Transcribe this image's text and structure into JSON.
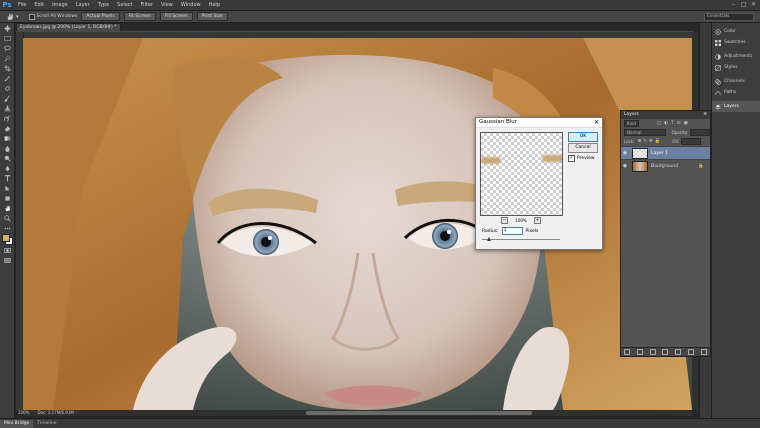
{
  "app": {
    "logo": "Ps"
  },
  "menu": [
    "File",
    "Edit",
    "Image",
    "Layer",
    "Type",
    "Select",
    "Filter",
    "View",
    "Window",
    "Help"
  ],
  "window_controls": [
    "–",
    "□",
    "✕"
  ],
  "options_bar": {
    "scroll_all_label": "Scroll All Windows",
    "buttons": [
      "Actual Pixels",
      "Fit Screen",
      "Fill Screen",
      "Print Size"
    ],
    "workspace": "Essentials"
  },
  "document": {
    "tab_title": "Eyebrows.jpg @ 200% (Layer 1, RGB/8#) *",
    "zoom": "200%",
    "doc_info": "Doc: 3.17M/6.91M"
  },
  "bottom_tabs": [
    "Mini Bridge",
    "Timeline"
  ],
  "dock_panels": [
    {
      "label": "Color",
      "icon": "color-icon"
    },
    {
      "label": "Swatches",
      "icon": "swatches-icon"
    },
    {
      "label": "Adjustments",
      "icon": "adjustments-icon"
    },
    {
      "label": "Styles",
      "icon": "styles-icon"
    },
    {
      "label": "Channels",
      "icon": "channels-icon"
    },
    {
      "label": "Paths",
      "icon": "paths-icon"
    },
    {
      "label": "Layers",
      "icon": "layers-icon"
    }
  ],
  "layers_panel": {
    "title": "Layers",
    "filter": "Kind",
    "blend_mode": "Normal",
    "opacity_label": "Opacity:",
    "lock_label": "Lock:",
    "fill_label": "Fill:",
    "layers": [
      {
        "name": "Layer 1",
        "selected": true
      },
      {
        "name": "Background",
        "selected": false
      }
    ]
  },
  "gaussian_blur": {
    "title": "Gaussian Blur",
    "ok_label": "OK",
    "cancel_label": "Cancel",
    "preview_label": "Preview",
    "preview_checked": true,
    "zoom": "100%",
    "radius_label": "Radius:",
    "radius_value": "1",
    "radius_unit": "Pixels"
  },
  "colors": {
    "brow_color": "#c9a87a",
    "selection_accent": "#6b7f9e"
  }
}
